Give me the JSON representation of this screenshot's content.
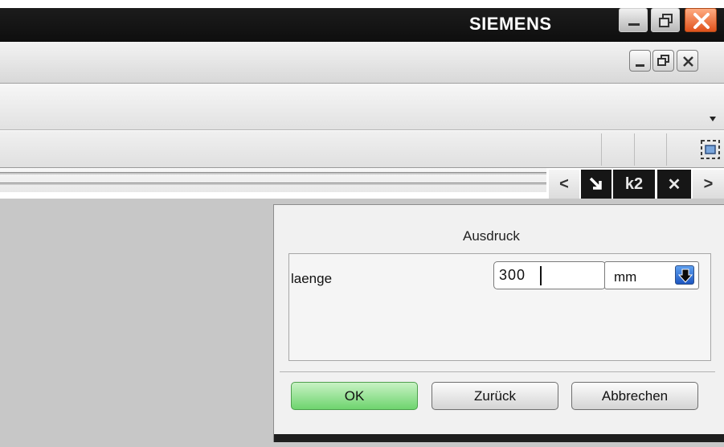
{
  "titlebar": {
    "brand": "SIEMENS"
  },
  "breadcrumb": {
    "prev": "<",
    "current": "k2",
    "close": "✕",
    "next": ">"
  },
  "dialog": {
    "title": "Ausdruck",
    "expression": {
      "name": "laenge",
      "value": "300",
      "unit": "mm"
    },
    "buttons": {
      "ok": "OK",
      "back": "Zurück",
      "cancel": "Abbrechen"
    }
  },
  "colors": {
    "titlebar": "#111111",
    "close": "#e0521c",
    "ok": "#6ed46e",
    "graphics": "#c7c7c7"
  },
  "icons": [
    "minimize-icon",
    "restore-icon",
    "close-icon",
    "dropdown-arrow-icon",
    "fit-view-icon",
    "arrow-down-right-icon",
    "dropdown-down-arrow-icon"
  ]
}
